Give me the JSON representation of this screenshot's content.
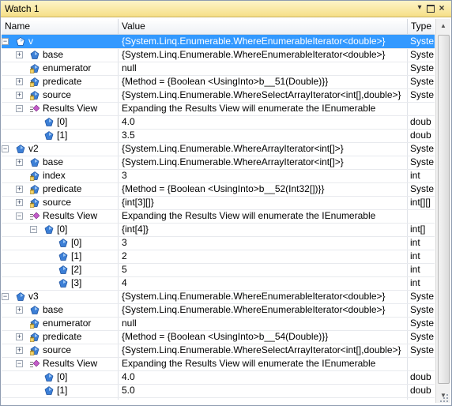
{
  "window": {
    "title": "Watch 1",
    "dropdown_glyph": "▾",
    "close_glyph": "×"
  },
  "columns": {
    "name": "Name",
    "value": "Value",
    "type": "Type"
  },
  "scrollbar": {
    "up": "▲",
    "down": "▼"
  },
  "rows": [
    {
      "id": "v",
      "depth": 0,
      "expander": "minus",
      "icon": "variable-icon",
      "name": "v",
      "value": "{System.Linq.Enumerable.WhereEnumerableIterator<double>}",
      "type": "Syster",
      "selected": true
    },
    {
      "id": "v-base",
      "depth": 1,
      "expander": "plus",
      "icon": "field-icon",
      "name": "base",
      "value": "{System.Linq.Enumerable.WhereEnumerableIterator<double>}",
      "type": "Syster"
    },
    {
      "id": "v-enumerator",
      "depth": 1,
      "expander": "none",
      "icon": "private-field-icon",
      "name": "enumerator",
      "value": "null",
      "type": "Syster"
    },
    {
      "id": "v-predicate",
      "depth": 1,
      "expander": "plus",
      "icon": "private-field-icon",
      "name": "predicate",
      "value": "{Method = {Boolean <UsingInto>b__51(Double)}}",
      "type": "Syster"
    },
    {
      "id": "v-source",
      "depth": 1,
      "expander": "plus",
      "icon": "private-field-icon",
      "name": "source",
      "value": "{System.Linq.Enumerable.WhereSelectArrayIterator<int[],double>}",
      "type": "Syster"
    },
    {
      "id": "v-results",
      "depth": 1,
      "expander": "minus",
      "icon": "results-view-icon",
      "name": "Results View",
      "value": "Expanding the Results View will enumerate the IEnumerable",
      "type": ""
    },
    {
      "id": "v-r0",
      "depth": 2,
      "expander": "none",
      "icon": "element-icon",
      "name": "[0]",
      "value": "4.0",
      "type": "doub"
    },
    {
      "id": "v-r1",
      "depth": 2,
      "expander": "none",
      "icon": "element-icon",
      "name": "[1]",
      "value": "3.5",
      "type": "doub"
    },
    {
      "id": "v2",
      "depth": 0,
      "expander": "minus",
      "icon": "variable-icon",
      "name": "v2",
      "value": "{System.Linq.Enumerable.WhereArrayIterator<int[]>}",
      "type": "Syster"
    },
    {
      "id": "v2-base",
      "depth": 1,
      "expander": "plus",
      "icon": "field-icon",
      "name": "base",
      "value": "{System.Linq.Enumerable.WhereArrayIterator<int[]>}",
      "type": "Syster"
    },
    {
      "id": "v2-index",
      "depth": 1,
      "expander": "none",
      "icon": "private-field-icon",
      "name": "index",
      "value": "3",
      "type": "int"
    },
    {
      "id": "v2-predicate",
      "depth": 1,
      "expander": "plus",
      "icon": "private-field-icon",
      "name": "predicate",
      "value": "{Method = {Boolean <UsingInto>b__52(Int32[])}}",
      "type": "Syster"
    },
    {
      "id": "v2-source",
      "depth": 1,
      "expander": "plus",
      "icon": "private-field-icon",
      "name": "source",
      "value": "{int[3][]}",
      "type": "int[][]"
    },
    {
      "id": "v2-results",
      "depth": 1,
      "expander": "minus",
      "icon": "results-view-icon",
      "name": "Results View",
      "value": "Expanding the Results View will enumerate the IEnumerable",
      "type": ""
    },
    {
      "id": "v2-r0",
      "depth": 2,
      "expander": "minus",
      "icon": "element-icon",
      "name": "[0]",
      "value": "{int[4]}",
      "type": "int[]"
    },
    {
      "id": "v2-r00",
      "depth": 3,
      "expander": "none",
      "icon": "element-icon",
      "name": "[0]",
      "value": "3",
      "type": "int"
    },
    {
      "id": "v2-r01",
      "depth": 3,
      "expander": "none",
      "icon": "element-icon",
      "name": "[1]",
      "value": "2",
      "type": "int"
    },
    {
      "id": "v2-r02",
      "depth": 3,
      "expander": "none",
      "icon": "element-icon",
      "name": "[2]",
      "value": "5",
      "type": "int"
    },
    {
      "id": "v2-r03",
      "depth": 3,
      "expander": "none",
      "icon": "element-icon",
      "name": "[3]",
      "value": "4",
      "type": "int"
    },
    {
      "id": "v3",
      "depth": 0,
      "expander": "minus",
      "icon": "variable-icon",
      "name": "v3",
      "value": "{System.Linq.Enumerable.WhereEnumerableIterator<double>}",
      "type": "Syster"
    },
    {
      "id": "v3-base",
      "depth": 1,
      "expander": "plus",
      "icon": "field-icon",
      "name": "base",
      "value": "{System.Linq.Enumerable.WhereEnumerableIterator<double>}",
      "type": "Syster"
    },
    {
      "id": "v3-enumerator",
      "depth": 1,
      "expander": "none",
      "icon": "private-field-icon",
      "name": "enumerator",
      "value": "null",
      "type": "Syster"
    },
    {
      "id": "v3-predicate",
      "depth": 1,
      "expander": "plus",
      "icon": "private-field-icon",
      "name": "predicate",
      "value": "{Method = {Boolean <UsingInto>b__54(Double)}}",
      "type": "Syster"
    },
    {
      "id": "v3-source",
      "depth": 1,
      "expander": "plus",
      "icon": "private-field-icon",
      "name": "source",
      "value": "{System.Linq.Enumerable.WhereSelectArrayIterator<int[],double>}",
      "type": "Syster"
    },
    {
      "id": "v3-results",
      "depth": 1,
      "expander": "minus",
      "icon": "results-view-icon",
      "name": "Results View",
      "value": "Expanding the Results View will enumerate the IEnumerable",
      "type": ""
    },
    {
      "id": "v3-r0",
      "depth": 2,
      "expander": "none",
      "icon": "element-icon",
      "name": "[0]",
      "value": "4.0",
      "type": "doub"
    },
    {
      "id": "v3-r1",
      "depth": 2,
      "expander": "none",
      "icon": "element-icon",
      "name": "[1]",
      "value": "5.0",
      "type": "doub"
    }
  ]
}
